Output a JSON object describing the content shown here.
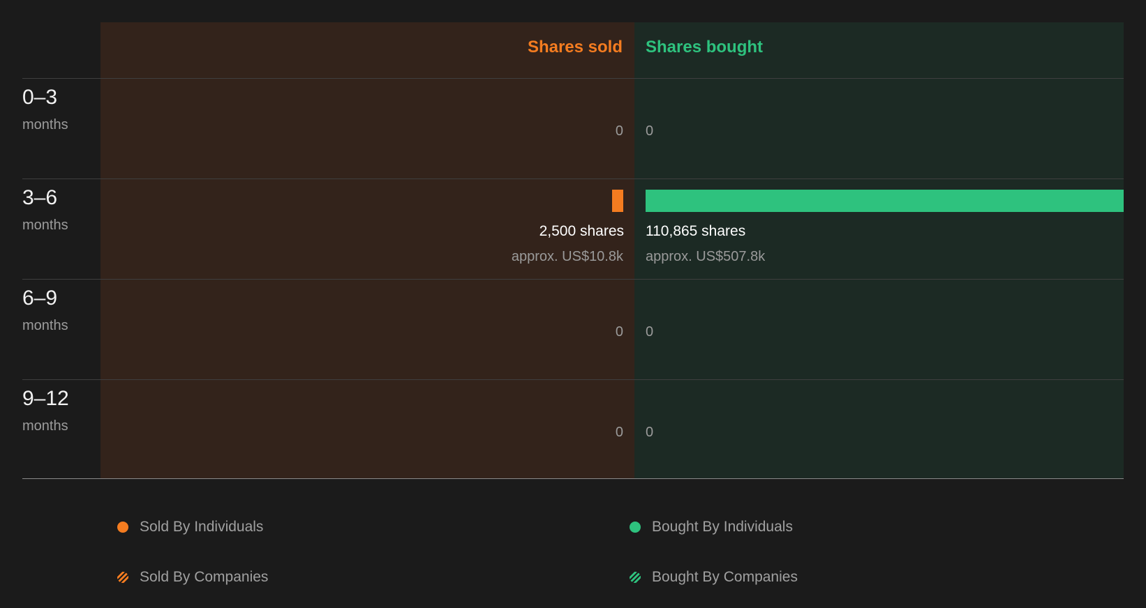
{
  "header": {
    "sold_label": "Shares sold",
    "bought_label": "Shares bought"
  },
  "colors": {
    "sold": "#f47c20",
    "bought": "#2ec27e",
    "sold_bg": "#33231b",
    "bought_bg": "#1c2a24",
    "page_bg": "#1b1b1b"
  },
  "periods": [
    {
      "range": "0–3",
      "unit": "months",
      "sold_text": "0",
      "bought_text": "0"
    },
    {
      "range": "3–6",
      "unit": "months",
      "sold_shares": "2,500 shares",
      "sold_approx": "approx. US$10.8k",
      "bought_shares": "110,865 shares",
      "bought_approx": "approx. US$507.8k"
    },
    {
      "range": "6–9",
      "unit": "months",
      "sold_text": "0",
      "bought_text": "0"
    },
    {
      "range": "9–12",
      "unit": "months",
      "sold_text": "0",
      "bought_text": "0"
    }
  ],
  "legend": [
    {
      "label": "Sold By Individuals",
      "icon": "solid-orange-dot"
    },
    {
      "label": "Bought By Individuals",
      "icon": "solid-green-dot"
    },
    {
      "label": "Sold By Companies",
      "icon": "hatched-orange-dot"
    },
    {
      "label": "Bought By Companies",
      "icon": "hatched-green-dot"
    }
  ],
  "chart_data": {
    "type": "bar",
    "categories": [
      "0–3 months",
      "3–6 months",
      "6–9 months",
      "9–12 months"
    ],
    "series": [
      {
        "name": "Shares sold",
        "values": [
          0,
          2500,
          0,
          0
        ]
      },
      {
        "name": "Shares bought",
        "values": [
          0,
          110865,
          0,
          0
        ]
      }
    ],
    "approx_value_usd": {
      "sold": [
        0,
        10800,
        0,
        0
      ],
      "bought": [
        0,
        507800,
        0,
        0
      ]
    },
    "max_value": 110865,
    "legend_position": "bottom"
  }
}
